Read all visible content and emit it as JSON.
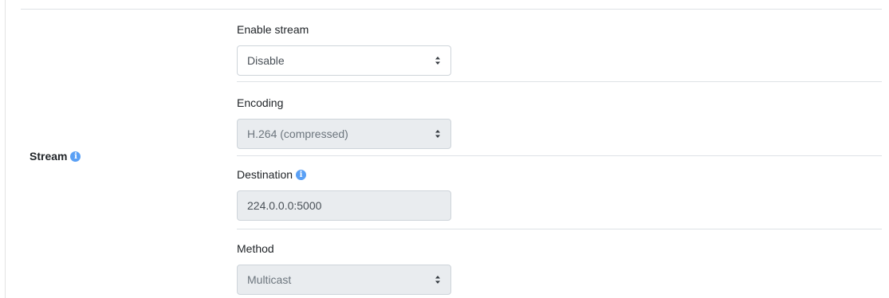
{
  "section": {
    "label": "Stream",
    "info_icon": "info-icon"
  },
  "fields": [
    {
      "label": "Enable stream",
      "value": "Disable",
      "type": "select",
      "disabled": false
    },
    {
      "label": "Encoding",
      "value": "H.264 (compressed)",
      "type": "select",
      "disabled": true
    },
    {
      "label": "Destination",
      "value": "224.0.0.0:5000",
      "type": "input",
      "disabled": true,
      "has_info": true
    },
    {
      "label": "Method",
      "value": "Multicast",
      "type": "select",
      "disabled": true
    }
  ],
  "colors": {
    "info_icon": "#5aa0f5",
    "disabled_bg": "#e9ecef",
    "border": "#ced4da"
  }
}
